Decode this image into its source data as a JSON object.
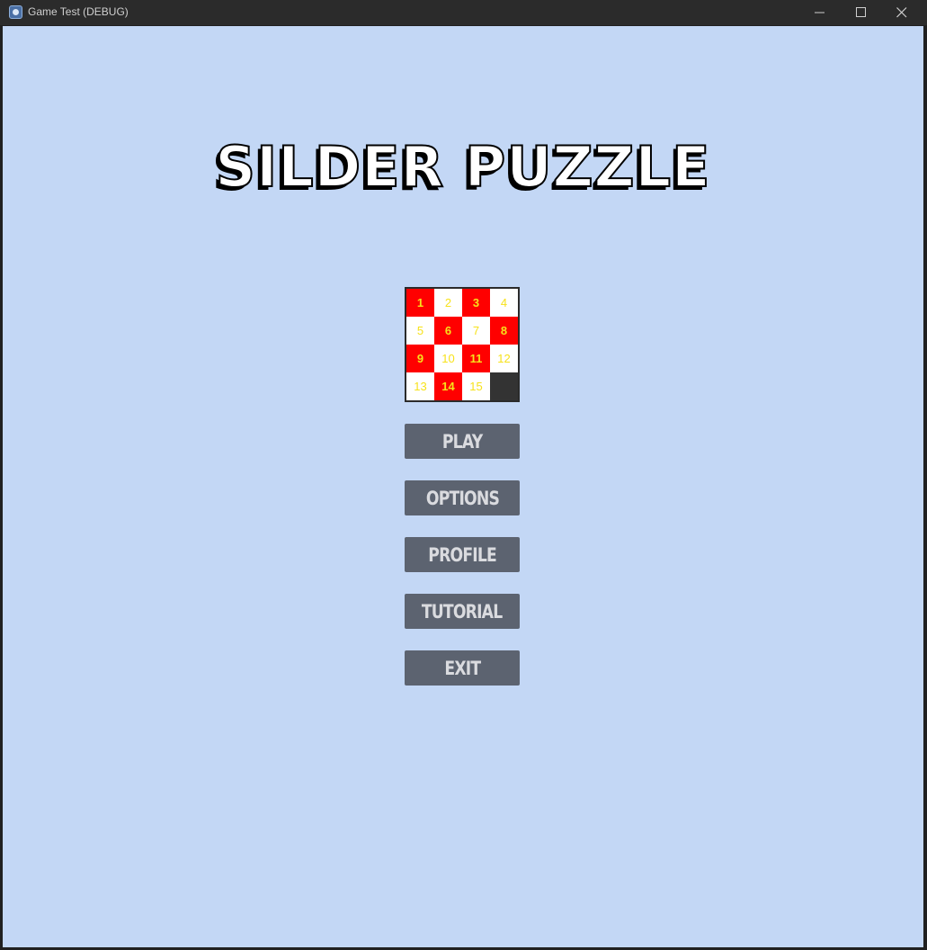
{
  "window": {
    "title": "Game Test (DEBUG)",
    "icon": "game-engine-icon",
    "controls": [
      "minimize-icon",
      "maximize-icon",
      "close-icon"
    ]
  },
  "game": {
    "title": "SILDER PUZZLE",
    "background_color": "#c3d7f5",
    "puzzle": {
      "tiles": [
        {
          "label": "1",
          "color": "red"
        },
        {
          "label": "2",
          "color": "white"
        },
        {
          "label": "3",
          "color": "red"
        },
        {
          "label": "4",
          "color": "white"
        },
        {
          "label": "5",
          "color": "white"
        },
        {
          "label": "6",
          "color": "red"
        },
        {
          "label": "7",
          "color": "white"
        },
        {
          "label": "8",
          "color": "red"
        },
        {
          "label": "9",
          "color": "red"
        },
        {
          "label": "10",
          "color": "white"
        },
        {
          "label": "11",
          "color": "red"
        },
        {
          "label": "12",
          "color": "white"
        },
        {
          "label": "13",
          "color": "white"
        },
        {
          "label": "14",
          "color": "red"
        },
        {
          "label": "15",
          "color": "white"
        },
        {
          "label": "",
          "color": "empty"
        }
      ],
      "colors": {
        "red": "#ff0000",
        "white": "#ffffff",
        "empty": "#333333",
        "number": "#f7e21b"
      }
    },
    "menu": {
      "play": "PLAY",
      "options": "OPTIONS",
      "profile": "PROFILE",
      "tutorial": "TUTORIAL",
      "exit": "EXIT"
    },
    "button_color": "#5c6370"
  }
}
